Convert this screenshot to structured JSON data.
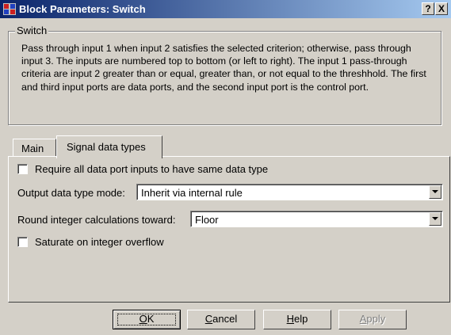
{
  "window": {
    "title": "Block Parameters: Switch",
    "help_button": "?",
    "close_button": "X"
  },
  "group": {
    "label": "Switch",
    "description": "Pass through input 1 when input 2 satisfies the selected criterion; otherwise, pass through input 3.  The inputs are numbered top to bottom (or left to right). The input 1 pass-through criteria are input 2 greater than or equal, greater than, or not equal to the threshhold.  The first and third input ports are data ports, and the second input port is the control port."
  },
  "tabs": [
    {
      "label": "Main"
    },
    {
      "label": "Signal data types"
    }
  ],
  "signal_tab": {
    "require_same_type": {
      "label": "Require all data port inputs to have same data type",
      "checked": false
    },
    "output_mode": {
      "label": "Output data type mode:",
      "value": "Inherit via internal rule"
    },
    "round_toward": {
      "label": "Round integer calculations toward:",
      "value": "Floor"
    },
    "saturate": {
      "label": "Saturate on integer overflow",
      "checked": false
    }
  },
  "buttons": {
    "ok": {
      "label": "OK",
      "mnemonic": "O",
      "rest": "K"
    },
    "cancel": {
      "label": "Cancel",
      "mnemonic": "C",
      "rest": "ancel"
    },
    "help": {
      "label": "Help",
      "mnemonic": "H",
      "rest": "elp"
    },
    "apply": {
      "label": "Apply",
      "mnemonic": "A",
      "rest": "pply"
    }
  }
}
